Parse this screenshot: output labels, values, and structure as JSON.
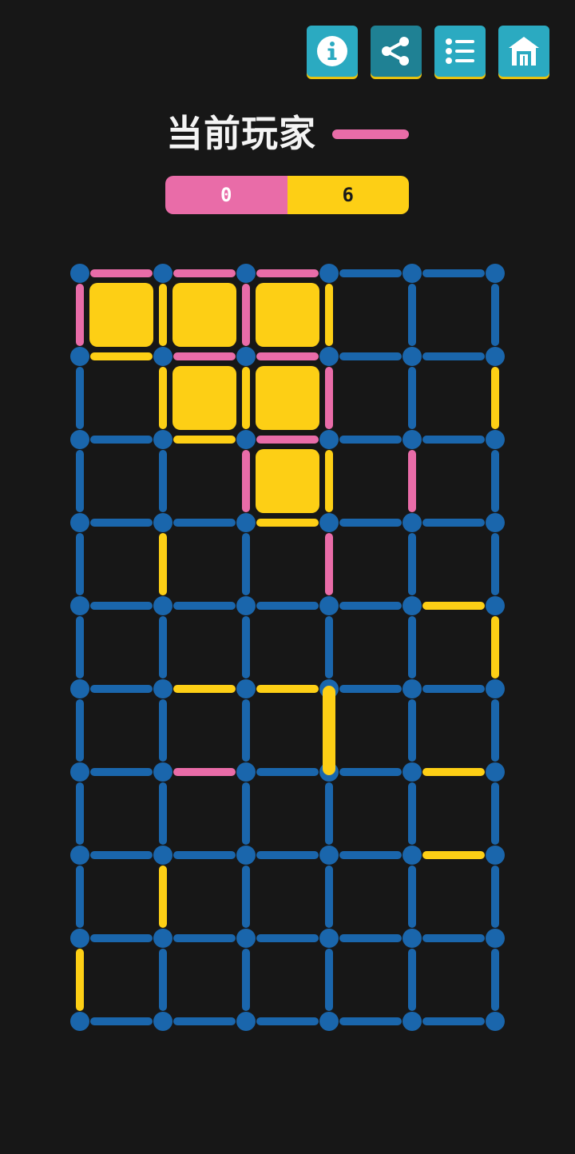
{
  "colors": {
    "background": "#171717",
    "neutral": "#1a66ac",
    "player1": "#e96ca8",
    "player2": "#fdcf15",
    "button_accent": "#2baac1",
    "button_share": "#1f8194"
  },
  "toolbar": {
    "buttons": [
      {
        "name": "info-button",
        "icon": "info-icon"
      },
      {
        "name": "share-button",
        "icon": "share-icon"
      },
      {
        "name": "levels-button",
        "icon": "list-icon"
      },
      {
        "name": "home-button",
        "icon": "home-icon"
      }
    ]
  },
  "status": {
    "current_player_label": "当前玩家",
    "current_player": "player1"
  },
  "score": {
    "player1": "0",
    "player2": "6"
  },
  "board": {
    "dot_columns": 6,
    "dot_rows": 10,
    "horizontal_edges": [
      [
        "p1",
        "p1",
        "p1",
        "n",
        "n"
      ],
      [
        "p2",
        "p1",
        "p1",
        "n",
        "n"
      ],
      [
        "n",
        "p2",
        "p1",
        "n",
        "n"
      ],
      [
        "n",
        "n",
        "p2",
        "n",
        "n"
      ],
      [
        "n",
        "n",
        "n",
        "n",
        "p2"
      ],
      [
        "n",
        "p2",
        "p2",
        "n",
        "n"
      ],
      [
        "n",
        "p1",
        "n",
        "n",
        "p2"
      ],
      [
        "n",
        "n",
        "n",
        "n",
        "p2"
      ],
      [
        "n",
        "n",
        "n",
        "n",
        "n"
      ],
      [
        "n",
        "n",
        "n",
        "n",
        "n"
      ]
    ],
    "vertical_edges": [
      [
        "p1",
        "p2",
        "p1",
        "p2",
        "n",
        "n"
      ],
      [
        "n",
        "p2",
        "p2",
        "p1",
        "n",
        "p2"
      ],
      [
        "n",
        "n",
        "p1",
        "p2",
        "p1",
        "n"
      ],
      [
        "n",
        "p2",
        "n",
        "p1",
        "n",
        "n"
      ],
      [
        "n",
        "n",
        "n",
        "n",
        "n",
        "p2"
      ],
      [
        "n",
        "n",
        "n",
        "p2",
        "n",
        "n"
      ],
      [
        "n",
        "n",
        "n",
        "n",
        "n",
        "n"
      ],
      [
        "n",
        "p2",
        "n",
        "n",
        "n",
        "n"
      ],
      [
        "p2",
        "n",
        "n",
        "n",
        "n",
        "n"
      ]
    ],
    "boxes": [
      [
        "p2",
        "p2",
        "p2",
        "",
        ""
      ],
      [
        "",
        "p2",
        "p2",
        "",
        ""
      ],
      [
        "",
        "",
        "p2",
        "",
        ""
      ],
      [
        "",
        "",
        "",
        "",
        ""
      ],
      [
        "",
        "",
        "",
        "",
        ""
      ],
      [
        "",
        "",
        "",
        "",
        ""
      ],
      [
        "",
        "",
        "",
        "",
        ""
      ],
      [
        "",
        "",
        "",
        "",
        ""
      ],
      [
        "",
        "",
        "",
        "",
        ""
      ]
    ]
  }
}
